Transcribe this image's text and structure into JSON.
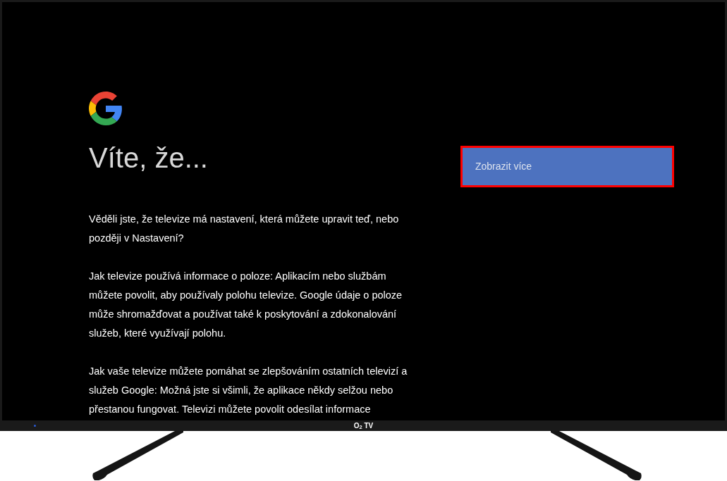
{
  "screen": {
    "title": "Víte, že...",
    "paragraphs": [
      "Věděli jste, že televize má nastavení, která můžete upravit teď, nebo později v Nastavení?",
      "Jak televize používá informace o poloze: Aplikacím nebo službám můžete povolit, aby používaly polohu televize. Google údaje o poloze může shromažďovat a používat také k poskytování a zdokonalování služeb, které využívají polohu.",
      "Jak vaše televize můžete pomáhat se zlepšováním ostatních televizí a služeb Google: Možná jste si všimli, že aplikace někdy selžou nebo přestanou fungovat. Televizi můžete povolit odesílat informace"
    ],
    "button": {
      "label": "Zobrazit více",
      "focused": true
    }
  },
  "bezel": {
    "logo": "O$_{2}$ TV"
  }
}
